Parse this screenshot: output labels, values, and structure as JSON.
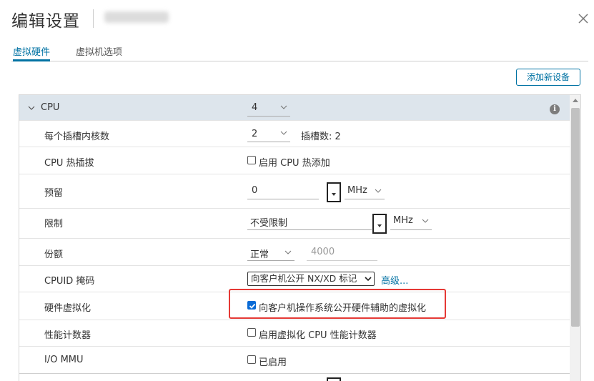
{
  "dialog": {
    "title": "编辑设置",
    "close_icon": "close-icon"
  },
  "tabs": [
    {
      "label": "虚拟硬件",
      "active": true
    },
    {
      "label": "虚拟机选项",
      "active": false
    }
  ],
  "toolbar": {
    "add_device_label": "添加新设备"
  },
  "cpu": {
    "label": "CPU",
    "value": "4",
    "rows": {
      "cores_per_socket": {
        "label": "每个插槽内核数",
        "value": "2",
        "sockets_text": "插槽数: 2"
      },
      "hot_plug": {
        "label": "CPU 热插拔",
        "checkbox_label": "启用 CPU 热添加",
        "checked": false
      },
      "reservation": {
        "label": "预留",
        "value": "0",
        "unit": "MHz"
      },
      "limit": {
        "label": "限制",
        "value": "不受限制",
        "unit": "MHz"
      },
      "shares": {
        "label": "份额",
        "level": "正常",
        "value_placeholder": "4000"
      },
      "cpuid_mask": {
        "label": "CPUID 掩码",
        "selected": "向客户机公开 NX/XD 标记",
        "advanced_link": "高级..."
      },
      "hw_virtualization": {
        "label": "硬件虚拟化",
        "checkbox_label": "向客户机操作系统公开硬件辅助的虚拟化",
        "checked": true
      },
      "perf_counters": {
        "label": "性能计数器",
        "checkbox_label": "启用虚拟化 CPU 性能计数器",
        "checked": false
      },
      "iommu": {
        "label": "I/O MMU",
        "checkbox_label": "已启用",
        "checked": false
      }
    }
  },
  "colors": {
    "accent": "#0072a3",
    "header_row": "#dde5ec",
    "checkbox_checked": "#0a6bd6",
    "highlight_box": "#e53935"
  }
}
